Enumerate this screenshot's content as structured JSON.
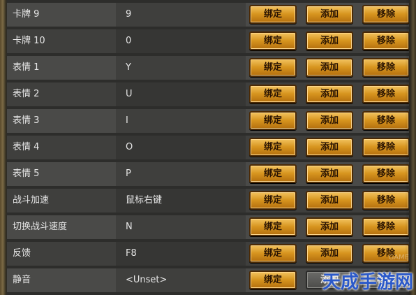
{
  "rows": [
    {
      "name": "卡牌 9",
      "key": "9"
    },
    {
      "name": "卡牌 10",
      "key": "0"
    },
    {
      "name": "表情 1",
      "key": "Y"
    },
    {
      "name": "表情 2",
      "key": "U"
    },
    {
      "name": "表情 3",
      "key": "I"
    },
    {
      "name": "表情 4",
      "key": "O"
    },
    {
      "name": "表情 5",
      "key": "P"
    },
    {
      "name": "战斗加速",
      "key": "鼠标右键"
    },
    {
      "name": "切换战斗速度",
      "key": "N"
    },
    {
      "name": "反馈",
      "key": "F8"
    },
    {
      "name": "静音",
      "key": "<Unset>"
    }
  ],
  "buttons": {
    "bind": "绑定",
    "add": "添加",
    "remove": "移除"
  },
  "watermark": "天成手游网",
  "watermark_small": "GAME",
  "colors": {
    "button_gold": "#d7951f",
    "row_light": "#4a4a48",
    "row_dark": "#3f3f3d"
  }
}
